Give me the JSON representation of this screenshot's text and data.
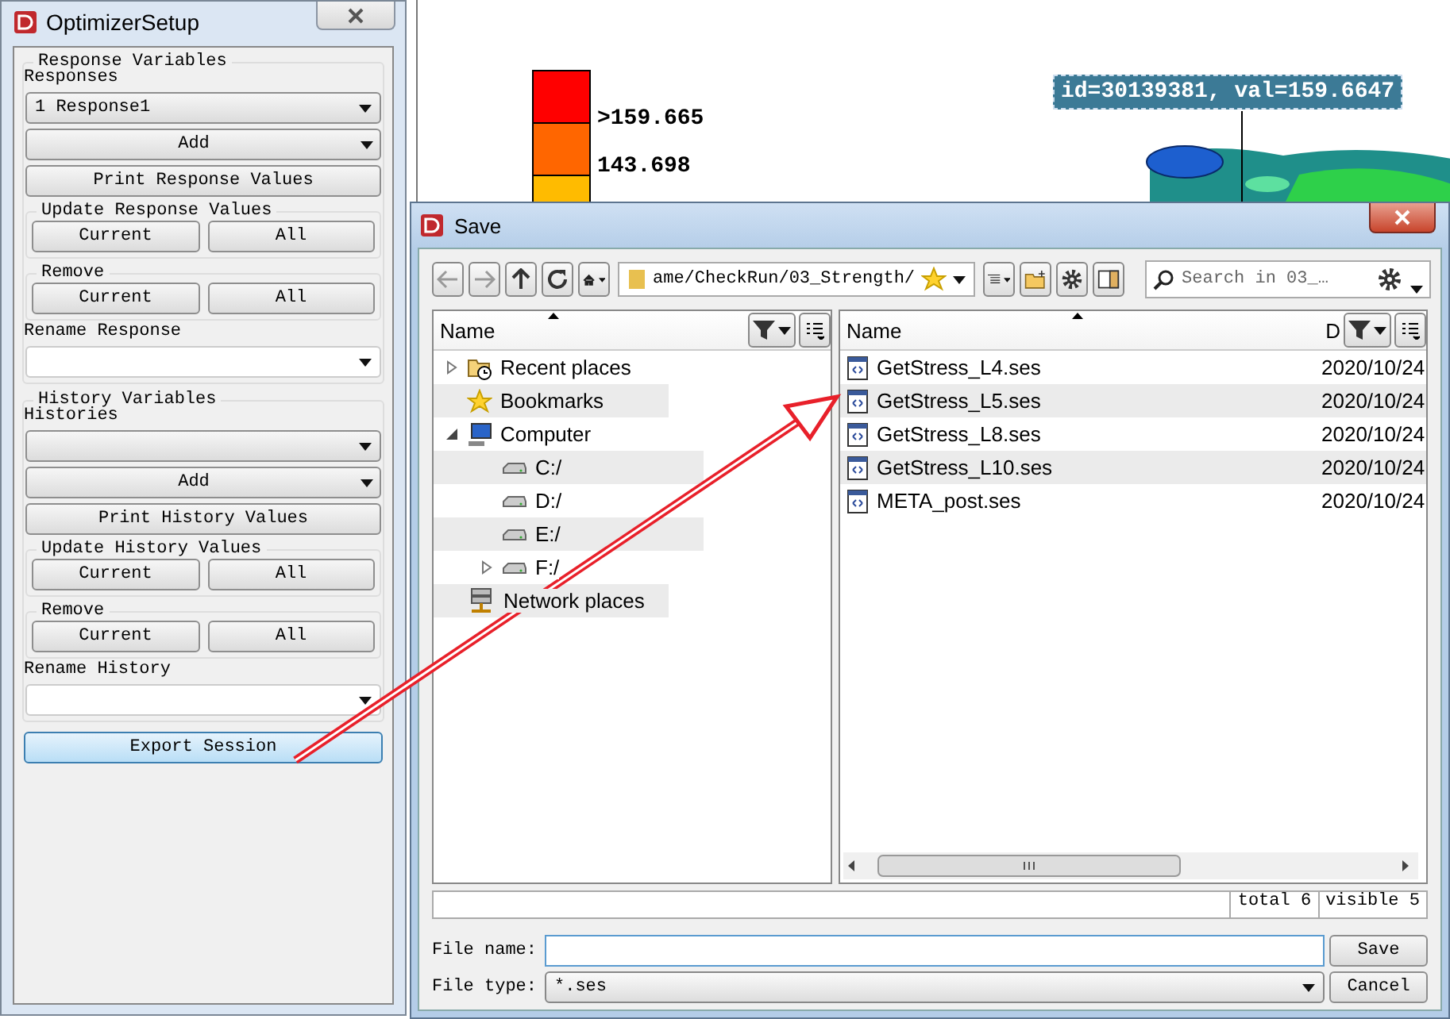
{
  "optimizer": {
    "title": "OptimizerSetup",
    "groups": [
      {
        "title": "Response Variables",
        "list_label": "Responses",
        "list_value": "1 Response1",
        "add_label": "Add",
        "print_label": "Print Response Values",
        "update": {
          "title": "Update Response Values",
          "buttons": [
            "Current",
            "All"
          ]
        },
        "remove": {
          "title": "Remove",
          "buttons": [
            "Current",
            "All"
          ]
        },
        "rename_label": "Rename Response"
      },
      {
        "title": "History Variables",
        "list_label": "Histories",
        "add_label": "Add",
        "print_label": "Print History Values",
        "update": {
          "title": "Update History Values",
          "buttons": [
            "Current",
            "All"
          ]
        },
        "remove": {
          "title": "Remove",
          "buttons": [
            "Current",
            "All"
          ]
        },
        "rename_label": "Rename History"
      }
    ],
    "export_label": "Export Session"
  },
  "viewport": {
    "legend": {
      "bands": [
        {
          "color": "#ff0000"
        },
        {
          "color": "#ff6600"
        },
        {
          "color": "#ffbb00"
        }
      ],
      "labels": [
        ">159.665",
        "143.698"
      ]
    },
    "probe_label": "id=30139381, val=159.6647"
  },
  "save_dialog": {
    "title": "Save",
    "path": "ame/CheckRun/03_Strength/",
    "search": {
      "placeholder": "Search in 03_…"
    },
    "tree": {
      "header": "Name",
      "items": [
        {
          "label": "Recent places",
          "kind": "recent",
          "expandable": true,
          "expanded": false
        },
        {
          "label": "Bookmarks",
          "kind": "bookmarks",
          "expandable": false
        },
        {
          "label": "Computer",
          "kind": "computer",
          "expandable": true,
          "expanded": true,
          "children": [
            {
              "label": "C:/",
              "kind": "drive",
              "expandable": false
            },
            {
              "label": "D:/",
              "kind": "drive",
              "expandable": false
            },
            {
              "label": "E:/",
              "kind": "drive",
              "expandable": false
            },
            {
              "label": "F:/",
              "kind": "drive",
              "expandable": true,
              "expanded": false
            }
          ]
        },
        {
          "label": "Network places",
          "kind": "network",
          "expandable": false
        }
      ]
    },
    "files": {
      "columns": [
        "Name",
        "D"
      ],
      "rows": [
        {
          "name": "GetStress_L4.ses",
          "date": "2020/10/24"
        },
        {
          "name": "GetStress_L5.ses",
          "date": "2020/10/24"
        },
        {
          "name": "GetStress_L8.ses",
          "date": "2020/10/24"
        },
        {
          "name": "GetStress_L10.ses",
          "date": "2020/10/24"
        },
        {
          "name": "META_post.ses",
          "date": "2020/10/24"
        }
      ]
    },
    "status": [
      "total 6",
      "visible 5"
    ],
    "file_name": {
      "label": "File name:"
    },
    "file_type": {
      "label": "File type:",
      "value": "*.ses"
    },
    "buttons": [
      "Save",
      "Cancel"
    ]
  }
}
